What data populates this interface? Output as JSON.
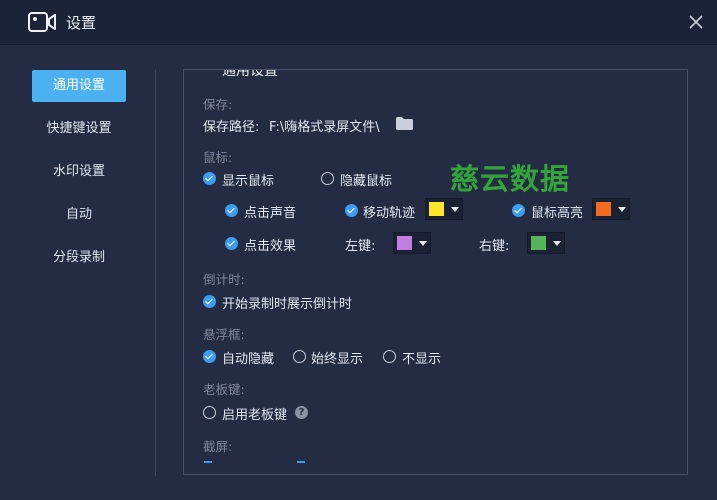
{
  "window": {
    "title": "设置"
  },
  "sidebar": {
    "items": [
      {
        "label": "通用设置",
        "active": true
      },
      {
        "label": "快捷键设置"
      },
      {
        "label": "水印设置"
      },
      {
        "label": "自动"
      },
      {
        "label": "分段录制"
      }
    ]
  },
  "panel": {
    "title": "通用设置",
    "save": {
      "section": "保存:",
      "path_label": "保存路径:",
      "path_value": "F:\\嗨格式录屏文件\\"
    },
    "mouse": {
      "section": "鼠标:",
      "show_cursor": {
        "label": "显示鼠标",
        "checked": true
      },
      "hide_cursor": {
        "label": "隐藏鼠标",
        "checked": false
      },
      "click_sound": {
        "label": "点击声音",
        "checked": true
      },
      "move_trail": {
        "label": "移动轨迹",
        "checked": true,
        "color": "#ffe62a"
      },
      "cursor_highlight": {
        "label": "鼠标高亮",
        "checked": true,
        "color": "#f26b21"
      },
      "click_effect": {
        "label": "点击效果",
        "checked": true
      },
      "left_key": {
        "label": "左键:",
        "color": "#c27ee0"
      },
      "right_key": {
        "label": "右键:",
        "color": "#56b45a"
      }
    },
    "countdown": {
      "section": "倒计时:",
      "show_countdown": {
        "label": "开始录制时展示倒计时",
        "checked": true
      }
    },
    "float_box": {
      "section": "悬浮框:",
      "auto_hide": {
        "label": "自动隐藏",
        "checked": true
      },
      "always_show": {
        "label": "始终显示",
        "checked": false
      },
      "never_show": {
        "label": "不显示",
        "checked": false
      }
    },
    "boss_key": {
      "section": "老板键:",
      "enable": {
        "label": "启用老板键",
        "checked": false
      }
    },
    "screenshot": {
      "section": "截屏:"
    }
  },
  "watermark_text": "慈云数据",
  "colors": {
    "accent": "#4cb1f0",
    "check": "#3e9cf0",
    "background": "#232c42",
    "titlebar": "#1b2337"
  }
}
